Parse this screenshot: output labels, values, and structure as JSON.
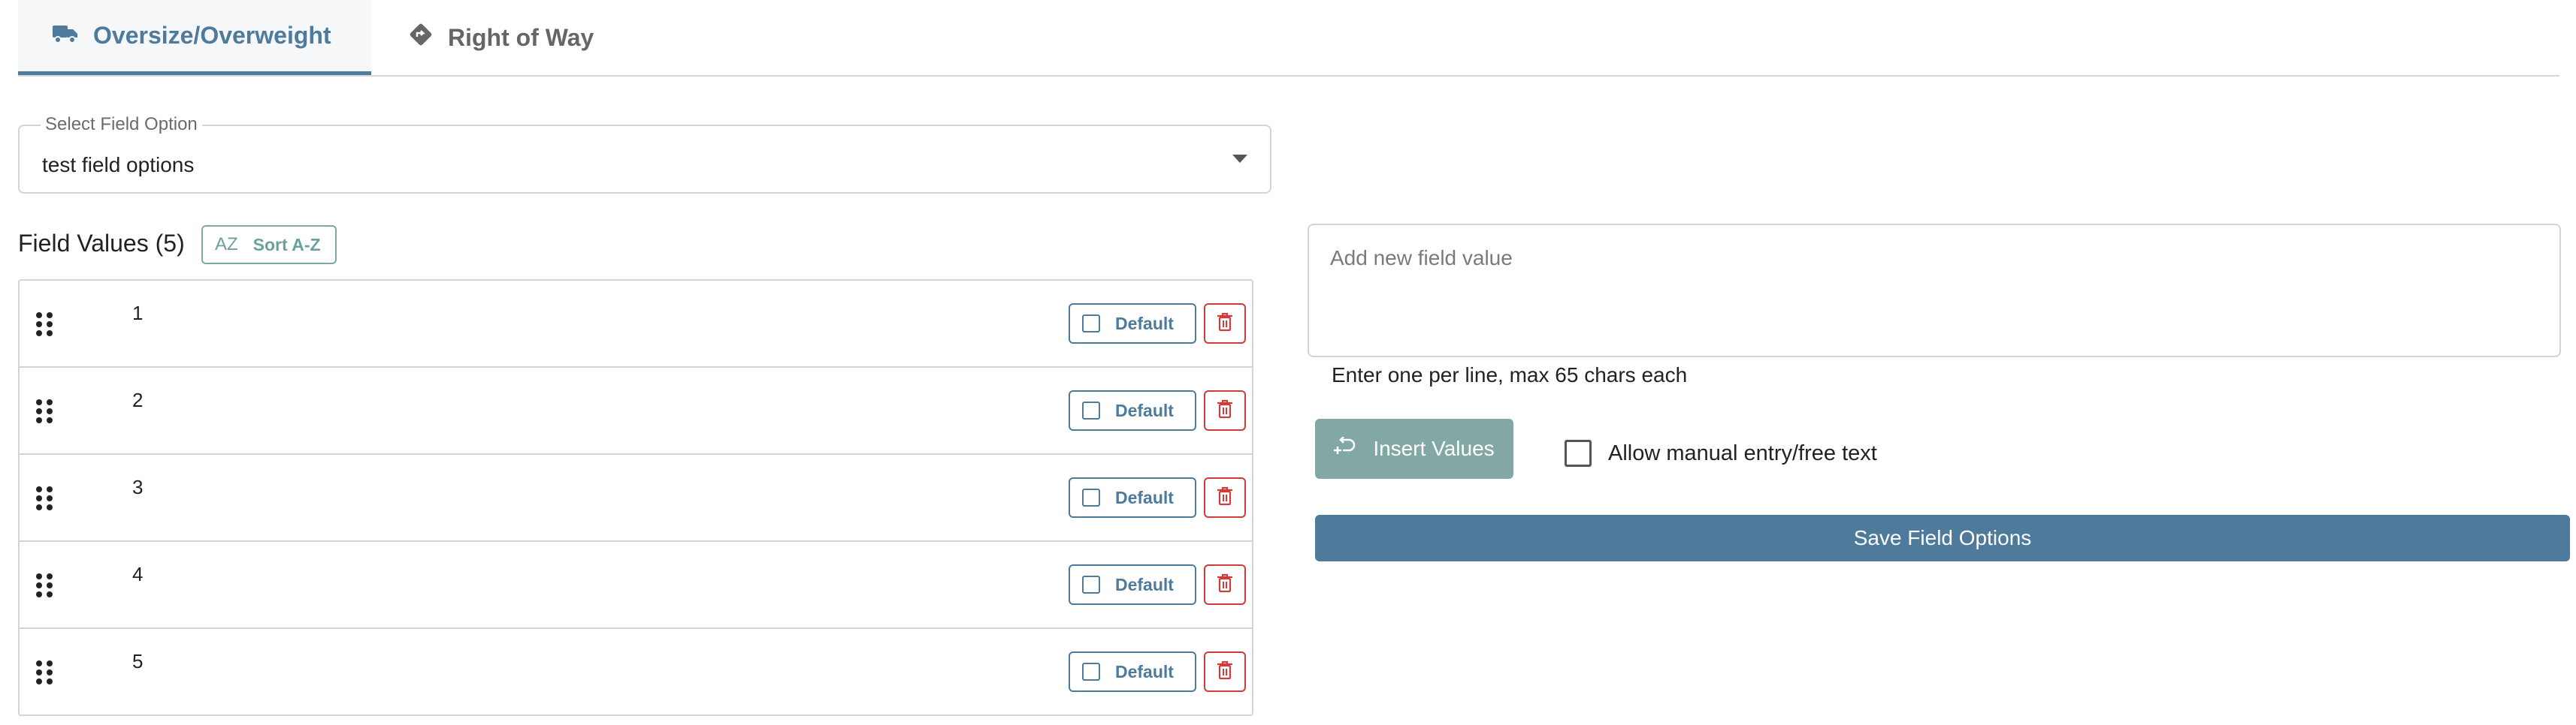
{
  "tabs": [
    {
      "label": "Oversize/Overweight",
      "icon": "truck-icon",
      "active": true
    },
    {
      "label": "Right of Way",
      "icon": "diamond-directions-icon",
      "active": false
    }
  ],
  "select": {
    "legend": "Select Field Option",
    "value": "test field options"
  },
  "field_values": {
    "title": "Field Values (5)",
    "sort_label": "Sort A-Z",
    "sort_icon_text": "AZ",
    "rows": [
      {
        "value": "1",
        "default_label": "Default"
      },
      {
        "value": "2",
        "default_label": "Default"
      },
      {
        "value": "3",
        "default_label": "Default"
      },
      {
        "value": "4",
        "default_label": "Default"
      },
      {
        "value": "5",
        "default_label": "Default"
      }
    ]
  },
  "new_value": {
    "placeholder": "Add new field value",
    "helper": "Enter one per line, max 65 chars each",
    "insert_label": "Insert Values",
    "manual_entry_label": "Allow manual entry/free text",
    "save_label": "Save Field Options"
  },
  "colors": {
    "accent": "#4e7a9c",
    "teal": "#82a8a6",
    "danger": "#d03b3b"
  }
}
